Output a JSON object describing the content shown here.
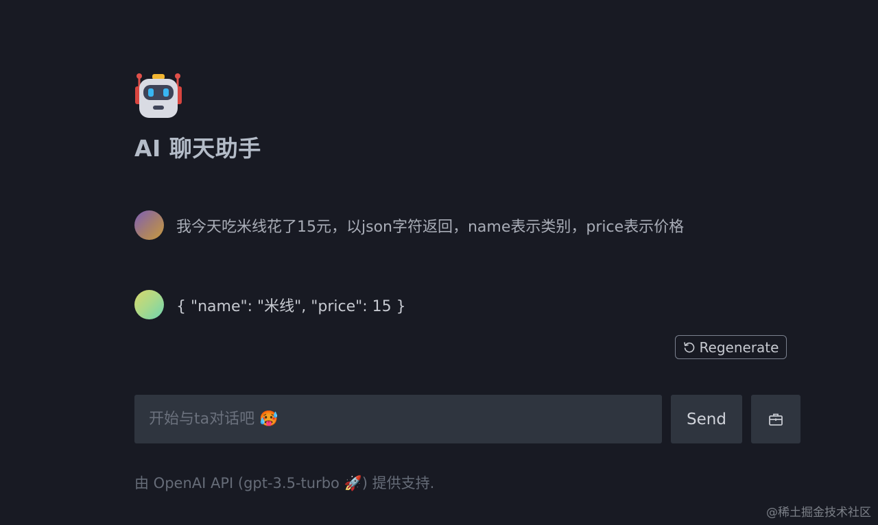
{
  "app": {
    "logo_icon": "robot-icon",
    "title": "AI 聊天助手"
  },
  "messages": [
    {
      "role": "user",
      "avatar": "user-avatar",
      "text": "我今天吃米线花了15元，以json字符返回，name表示类别，price表示价格"
    },
    {
      "role": "assistant",
      "avatar": "assistant-avatar",
      "text": "{ \"name\": \"米线\", \"price\": 15 }"
    }
  ],
  "actions": {
    "regenerate_label": "Regenerate",
    "regenerate_icon": "refresh-icon"
  },
  "composer": {
    "placeholder": "开始与ta对话吧 🥵",
    "value": "",
    "send_label": "Send",
    "tool_icon": "toolbox-icon"
  },
  "footer": {
    "text": "由 OpenAI API (gpt-3.5-turbo 🚀) 提供支持."
  },
  "watermark": "@稀土掘金技术社区",
  "colors": {
    "background": "#181a23",
    "input_bg": "#2f353f",
    "title": "#b4bcc8",
    "muted": "#666c78"
  }
}
